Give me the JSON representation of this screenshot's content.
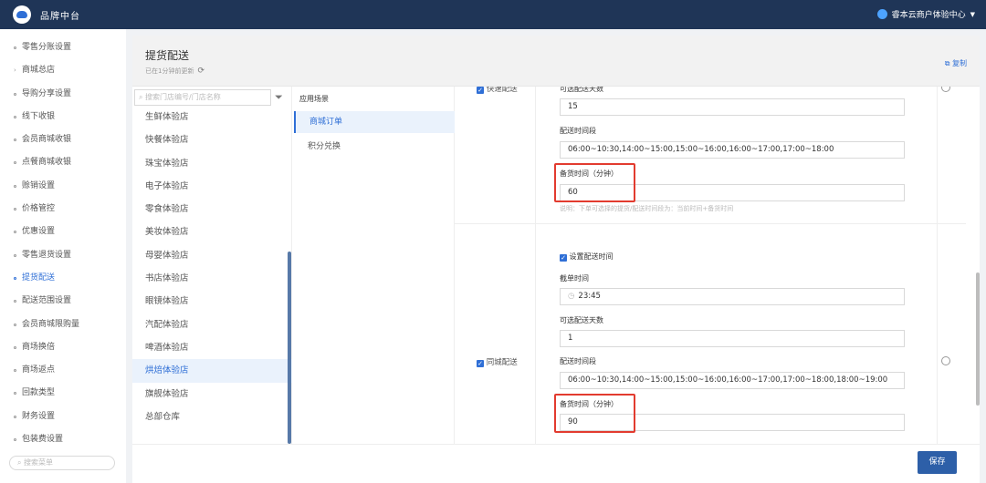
{
  "topbar": {
    "brand": "品牌中台",
    "user": "睿本云商户体验中心"
  },
  "sidebar": {
    "items": [
      "零售分账设置",
      "商城总店",
      "导购分享设置",
      "线下收银",
      "会员商城收银",
      "点餐商城收银",
      "赊销设置",
      "价格管控",
      "优惠设置",
      "零售退货设置",
      "提货配送",
      "配送范围设置",
      "会员商城限购量",
      "商场换倍",
      "商场返点",
      "回款类型",
      "财务设置",
      "包装费设置"
    ],
    "active_index": 10,
    "search_placeholder": "搜索菜单"
  },
  "panel": {
    "title": "提货配送",
    "subtitle": "已在1分钟前更新",
    "copy_label": "复制",
    "store_search_placeholder": "搜索门店编号/门店名称",
    "stores": [
      "生鲜体验店",
      "快餐体验店",
      "珠宝体验店",
      "电子体验店",
      "零食体验店",
      "美妆体验店",
      "母婴体验店",
      "书店体验店",
      "眼镜体验店",
      "汽配体验店",
      "啤酒体验店",
      "烘焙体验店",
      "旗舰体验店",
      "总部仓库"
    ],
    "selected_store_index": 11,
    "scene_header": "应用场景",
    "scenes": [
      "商城订单",
      "积分兑换"
    ],
    "section1": {
      "mode_label": "快速配送",
      "days_label": "可选配送天数",
      "days_value": "15",
      "slots_label": "配送时间段",
      "slots_value": "06:00~10:30,14:00~15:00,15:00~16:00,16:00~17:00,17:00~18:00",
      "prep_label": "备货时间（分钟）",
      "prep_value": "60",
      "hint": "说明：下单可选择的提货/配送时间段为：当前时间+备货时间"
    },
    "section2": {
      "mode_label": "同城配送",
      "set_time_label": "设置配送时间",
      "cutoff_label": "截单时间",
      "cutoff_value": "23:45",
      "days_label": "可选配送天数",
      "days_value": "1",
      "slots_label": "配送时间段",
      "slots_value": "06:00~10:30,14:00~15:00,15:00~16:00,16:00~17:00,17:00~18:00,18:00~19:00",
      "prep_label": "备货时间（分钟）",
      "prep_value": "90"
    },
    "save_label": "保存"
  },
  "colors": {
    "topbar": "#1f3557",
    "accent": "#2f6fd6",
    "highlight": "#e23b2f",
    "save": "#2d5fa8"
  }
}
